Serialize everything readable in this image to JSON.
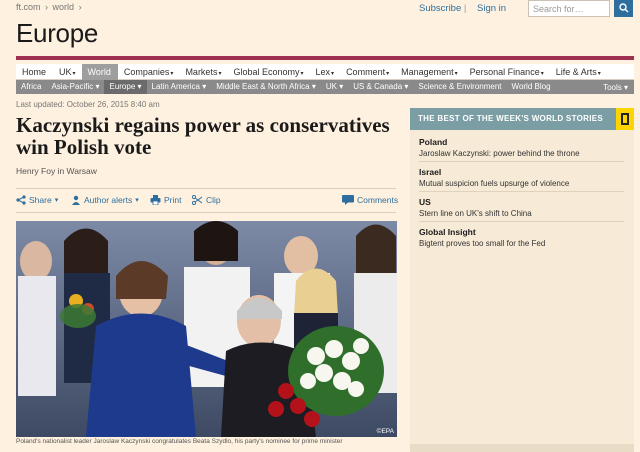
{
  "breadcrumb": {
    "home": "ft.com",
    "sep": "›",
    "section": "world",
    "sep2": "›"
  },
  "account": {
    "subscribe": "Subscribe",
    "sign_in": "Sign in"
  },
  "search": {
    "placeholder": "Search for…"
  },
  "section_title": "Europe",
  "nav": [
    {
      "label": "Home",
      "caret": ""
    },
    {
      "label": "UK",
      "caret": "▾"
    },
    {
      "label": "World",
      "caret": ""
    },
    {
      "label": "Companies",
      "caret": "▾"
    },
    {
      "label": "Markets",
      "caret": "▾"
    },
    {
      "label": "Global Economy",
      "caret": "▾"
    },
    {
      "label": "Lex",
      "caret": "▾"
    },
    {
      "label": "Comment",
      "caret": "▾"
    },
    {
      "label": "Management",
      "caret": "▾"
    },
    {
      "label": "Personal Finance",
      "caret": "▾"
    },
    {
      "label": "Life & Arts",
      "caret": "▾"
    }
  ],
  "subnav": [
    "Africa",
    "Asia-Pacific ▾",
    "Europe ▾",
    "Latin America ▾",
    "Middle East & North Africa ▾",
    "UK ▾",
    "US & Canada ▾",
    "Science & Environment",
    "World Blog"
  ],
  "subnav_tools": "Tools ▾",
  "article": {
    "updated": "Last updated: October 26, 2015 8:40 am",
    "headline": "Kaczynski regains power as conservatives win Polish vote",
    "byline": "Henry Foy in Warsaw",
    "tools": {
      "share": "Share",
      "author_alerts": "Author alerts",
      "print": "Print",
      "clip": "Clip",
      "comments": "Comments"
    },
    "photo_credit": "©EPA",
    "caption": "Poland's nationalist leader Jaroslaw Kaczynski congratulates Beata Szydlo, his party's nominee for prime minister"
  },
  "sidebar": {
    "heading": "THE BEST OF THE WEEK'S WORLD STORIES",
    "stories": [
      {
        "region": "Poland",
        "link": "Jaroslaw Kaczynski: power behind the throne"
      },
      {
        "region": "Israel",
        "link": "Mutual suspicion fuels upsurge of violence"
      },
      {
        "region": "US",
        "link": "Stern line on UK's shift to China"
      },
      {
        "region": "Global Insight",
        "link": "Bigtent proves too small for the Fed"
      }
    ]
  },
  "colors": {
    "background": "#fff1e0",
    "accent_rule": "#9e2f50",
    "link": "#2e6e9e",
    "sidebar_header": "#7b9ea5"
  }
}
